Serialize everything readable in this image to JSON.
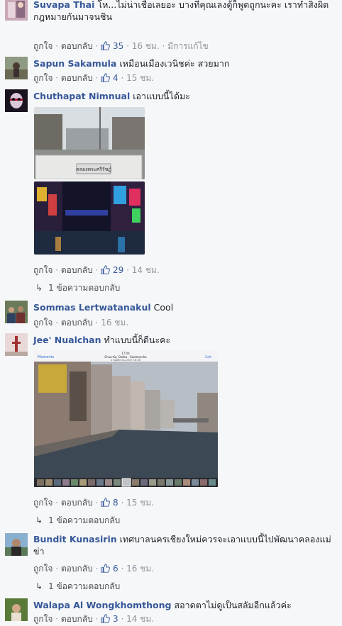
{
  "comments": [
    {
      "name": "Suvapa Thai",
      "text": "โห...ไม่น่าเชื่อเลยอะ บางทีคุณเลงตู้ก็พูดถูกนะคะ เราทำสิ่งผิดกฎหมายกันมาจนชิน",
      "actions": {
        "like": "ถูกใจ",
        "reply": "ตอบกลับ",
        "likes": "35",
        "time": "16 ชม.",
        "extra": "มีการแก้ไข"
      }
    },
    {
      "name": "Sapun Sakamula",
      "text": "เหมือนเมืองเวนิชค่ะ สวยมาก",
      "actions": {
        "like": "ถูกใจ",
        "reply": "ตอบกลับ",
        "likes": "4",
        "time": "15 ชม."
      }
    },
    {
      "name": "Chuthapat Nimnual",
      "text": "เอาแบบนี้ได้มะ",
      "photo_caption": "คลองพระศรีรัชฏ์",
      "actions": {
        "like": "ถูกใจ",
        "reply": "ตอบกลับ",
        "likes": "29",
        "time": "14 ชม."
      },
      "replies": "1 ข้อความตอบกลับ"
    },
    {
      "name": "Sommas Lertwatanakul",
      "text": "Cool",
      "actions": {
        "like": "ถูกใจ",
        "reply": "ตอบกลับ",
        "time": "16 ชม."
      }
    },
    {
      "name": "Jee' Nualchan",
      "text": "ทำแบบนี้ก็ดีนะคะ",
      "photo_header": {
        "back": "Moments",
        "time": "17:04",
        "title": "Chuo-Ku, Osaka - Soemoncho",
        "date": "2 พฤศจิกายน 2557 16:36",
        "edit": "Edit"
      },
      "actions": {
        "like": "ถูกใจ",
        "reply": "ตอบกลับ",
        "likes": "8",
        "time": "15 ชม."
      },
      "replies": "1 ข้อความตอบกลับ"
    },
    {
      "name": "Bundit Kunasirin",
      "text": "เทศบาลนครเชียงใหม่ควรจะเอาแบบนี้ไปพัฒนาคลองแม่ข่า",
      "actions": {
        "like": "ถูกใจ",
        "reply": "ตอบกลับ",
        "likes": "6",
        "time": "16 ชม."
      },
      "replies": "1 ข้อความตอบกลับ"
    },
    {
      "name": "Walapa Al Wongkhomthong",
      "text": "สอาดตาไม่ดูเป็นสลัมอีกแล้วค่ะ",
      "actions": {
        "like": "ถูกใจ",
        "reply": "ตอบกลับ",
        "likes": "3",
        "time": "14 ชม."
      }
    }
  ],
  "separator": " · ",
  "colors": {
    "name": "#365899",
    "meta": "#90949c",
    "background": "#f6f7f9"
  }
}
